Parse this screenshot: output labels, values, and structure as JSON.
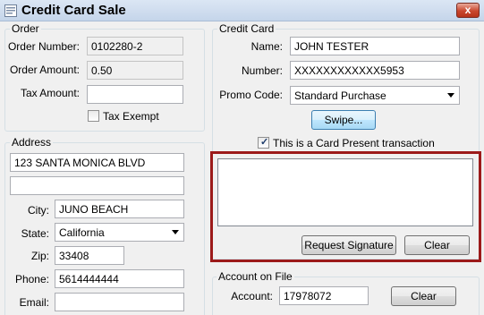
{
  "window": {
    "title": "Credit Card Sale",
    "close_glyph": "x"
  },
  "order": {
    "group_label": "Order",
    "order_number_label": "Order Number:",
    "order_number": "0102280-2",
    "order_amount_label": "Order Amount:",
    "order_amount": "0.50",
    "tax_amount_label": "Tax Amount:",
    "tax_amount": "",
    "tax_exempt_label": "Tax Exempt",
    "tax_exempt_checked": false
  },
  "address": {
    "group_label": "Address",
    "line1": "123 SANTA MONICA BLVD",
    "line2": "",
    "city_label": "City:",
    "city": "JUNO BEACH",
    "state_label": "State:",
    "state": "California",
    "zip_label": "Zip:",
    "zip": "33408",
    "phone_label": "Phone:",
    "phone": "5614444444",
    "email_label": "Email:",
    "email": ""
  },
  "credit_card": {
    "group_label": "Credit Card",
    "name_label": "Name:",
    "name": "JOHN TESTER",
    "number_label": "Number:",
    "number": "XXXXXXXXXXXX5953",
    "promo_label": "Promo Code:",
    "promo": "Standard Purchase",
    "swipe_label": "Swipe...",
    "card_present_label": "This is a Card Present transaction",
    "card_present_checked": true
  },
  "signature": {
    "request_label": "Request Signature",
    "clear_label": "Clear",
    "highlight_color": "#9c1a1a"
  },
  "account_on_file": {
    "group_label": "Account on File",
    "account_label": "Account:",
    "account": "17978072",
    "clear_label": "Clear"
  }
}
